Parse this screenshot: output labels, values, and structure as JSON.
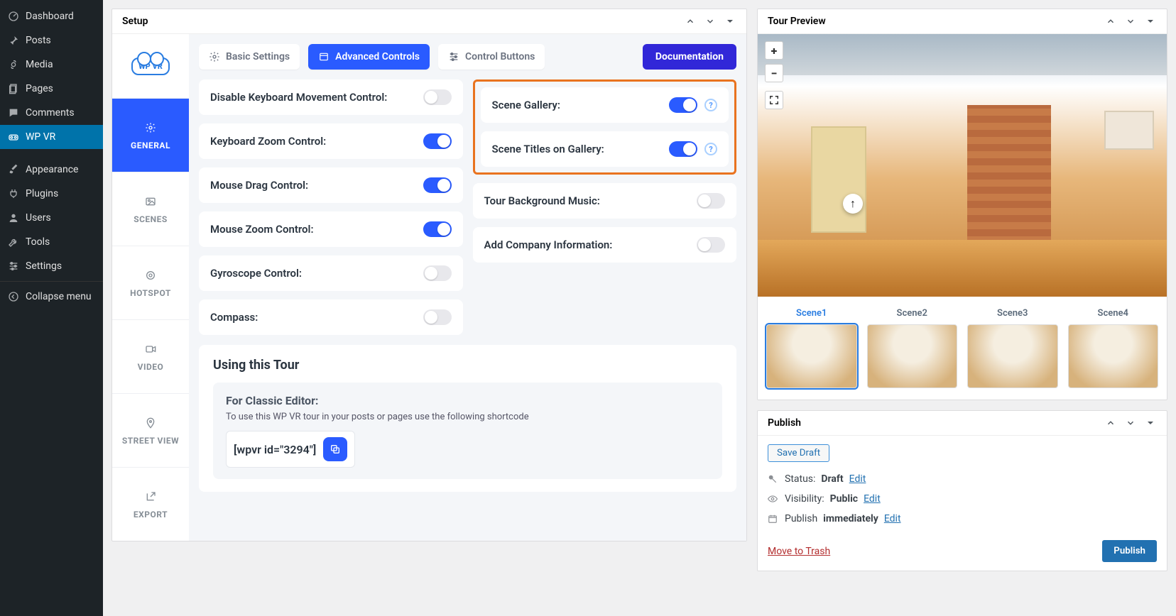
{
  "wp_sidebar": [
    {
      "label": "Dashboard",
      "icon": "dashboard"
    },
    {
      "label": "Posts",
      "icon": "pin"
    },
    {
      "label": "Media",
      "icon": "media"
    },
    {
      "label": "Pages",
      "icon": "pages"
    },
    {
      "label": "Comments",
      "icon": "comment"
    },
    {
      "label": "WP VR",
      "icon": "vr",
      "active": true
    },
    {
      "label": "Appearance",
      "icon": "brush"
    },
    {
      "label": "Plugins",
      "icon": "plug"
    },
    {
      "label": "Users",
      "icon": "user"
    },
    {
      "label": "Tools",
      "icon": "wrench"
    },
    {
      "label": "Settings",
      "icon": "sliders"
    },
    {
      "label": "Collapse menu",
      "icon": "collapse"
    }
  ],
  "setup": {
    "title": "Setup",
    "vtabs": [
      {
        "label": "GENERAL",
        "icon": "gear",
        "active": true
      },
      {
        "label": "SCENES",
        "icon": "image"
      },
      {
        "label": "HOTSPOT",
        "icon": "target"
      },
      {
        "label": "VIDEO",
        "icon": "video"
      },
      {
        "label": "STREET VIEW",
        "icon": "marker"
      },
      {
        "label": "EXPORT",
        "icon": "export"
      }
    ],
    "htabs": [
      {
        "label": "Basic Settings",
        "icon": "gear"
      },
      {
        "label": "Advanced Controls",
        "icon": "panel",
        "active": true
      },
      {
        "label": "Control Buttons",
        "icon": "sliders"
      }
    ],
    "doc_label": "Documentation",
    "left_toggles": [
      {
        "label": "Disable Keyboard Movement Control:",
        "on": false
      },
      {
        "label": "Keyboard Zoom Control:",
        "on": true
      },
      {
        "label": "Mouse Drag Control:",
        "on": true
      },
      {
        "label": "Mouse Zoom Control:",
        "on": true
      },
      {
        "label": "Gyroscope Control:",
        "on": false
      },
      {
        "label": "Compass:",
        "on": false
      }
    ],
    "right_highlight": [
      {
        "label": "Scene Gallery:",
        "on": true,
        "help": true
      },
      {
        "label": "Scene Titles on Gallery:",
        "on": true,
        "help": true
      }
    ],
    "right_toggles": [
      {
        "label": "Tour Background Music:",
        "on": false
      },
      {
        "label": "Add Company Information:",
        "on": false
      }
    ],
    "using": {
      "title": "Using this Tour",
      "classic_label": "For Classic Editor:",
      "desc": "To use this WP VR tour in your posts or pages use the following shortcode",
      "shortcode": "[wpvr id=\"3294\"]"
    },
    "logo_text": "WP VR"
  },
  "preview": {
    "title": "Tour Preview",
    "scenes": [
      "Scene1",
      "Scene2",
      "Scene3",
      "Scene4"
    ]
  },
  "publish": {
    "title": "Publish",
    "save_draft": "Save Draft",
    "status_label": "Status:",
    "status_value": "Draft",
    "visibility_label": "Visibility:",
    "visibility_value": "Public",
    "publish_label": "Publish",
    "publish_value": "immediately",
    "edit": "Edit",
    "trash": "Move to Trash",
    "publish_btn": "Publish"
  }
}
